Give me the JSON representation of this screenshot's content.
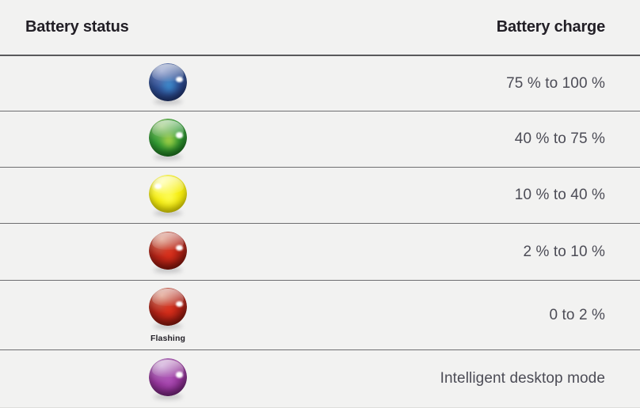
{
  "table": {
    "columns": [
      {
        "label": "Battery status",
        "name": "battery-status"
      },
      {
        "label": "Battery charge",
        "name": "battery-charge"
      }
    ],
    "rows": [
      {
        "icon": "blue-led-icon",
        "icon_colors": {
          "base_light": "#7d8fc4",
          "base_mid": "#2f4e92",
          "base_dark": "#17265a",
          "core": "#3f9fe0"
        },
        "note": "",
        "charge": "75 % to 100 %"
      },
      {
        "icon": "green-led-icon",
        "icon_colors": {
          "base_light": "#8fc36a",
          "base_mid": "#2f9a33",
          "base_dark": "#145d14",
          "core": "#cbe24b"
        },
        "note": "",
        "charge": "40 % to 75 %"
      },
      {
        "icon": "yellow-led-icon",
        "icon_colors": {
          "base_light": "#ffff9b",
          "base_mid": "#f7ef12",
          "base_dark": "#ddd000",
          "core": "#ffff66"
        },
        "note": "",
        "charge": "10 % to 40 %"
      },
      {
        "icon": "red-led-icon",
        "icon_colors": {
          "base_light": "#d98b72",
          "base_mid": "#b32317",
          "base_dark": "#6b1008",
          "core": "#e8341c"
        },
        "note": "",
        "charge": "2 % to 10 %"
      },
      {
        "icon": "red-flashing-led-icon",
        "icon_colors": {
          "base_light": "#d98b72",
          "base_mid": "#b32317",
          "base_dark": "#6b1008",
          "core": "#e8341c"
        },
        "note": "Flashing",
        "charge": "0 to 2 %"
      },
      {
        "icon": "purple-led-icon",
        "icon_colors": {
          "base_light": "#c295cf",
          "base_mid": "#96369c",
          "base_dark": "#5c1a62",
          "core": "#b457bd"
        },
        "note": "",
        "charge": "Intelligent desktop mode"
      }
    ]
  },
  "colors": {
    "background": "#f2f2f1",
    "header_text": "#221f26",
    "body_text": "#4c4c56",
    "header_rule": "#59595b",
    "row_rule": "#6e6e70"
  }
}
